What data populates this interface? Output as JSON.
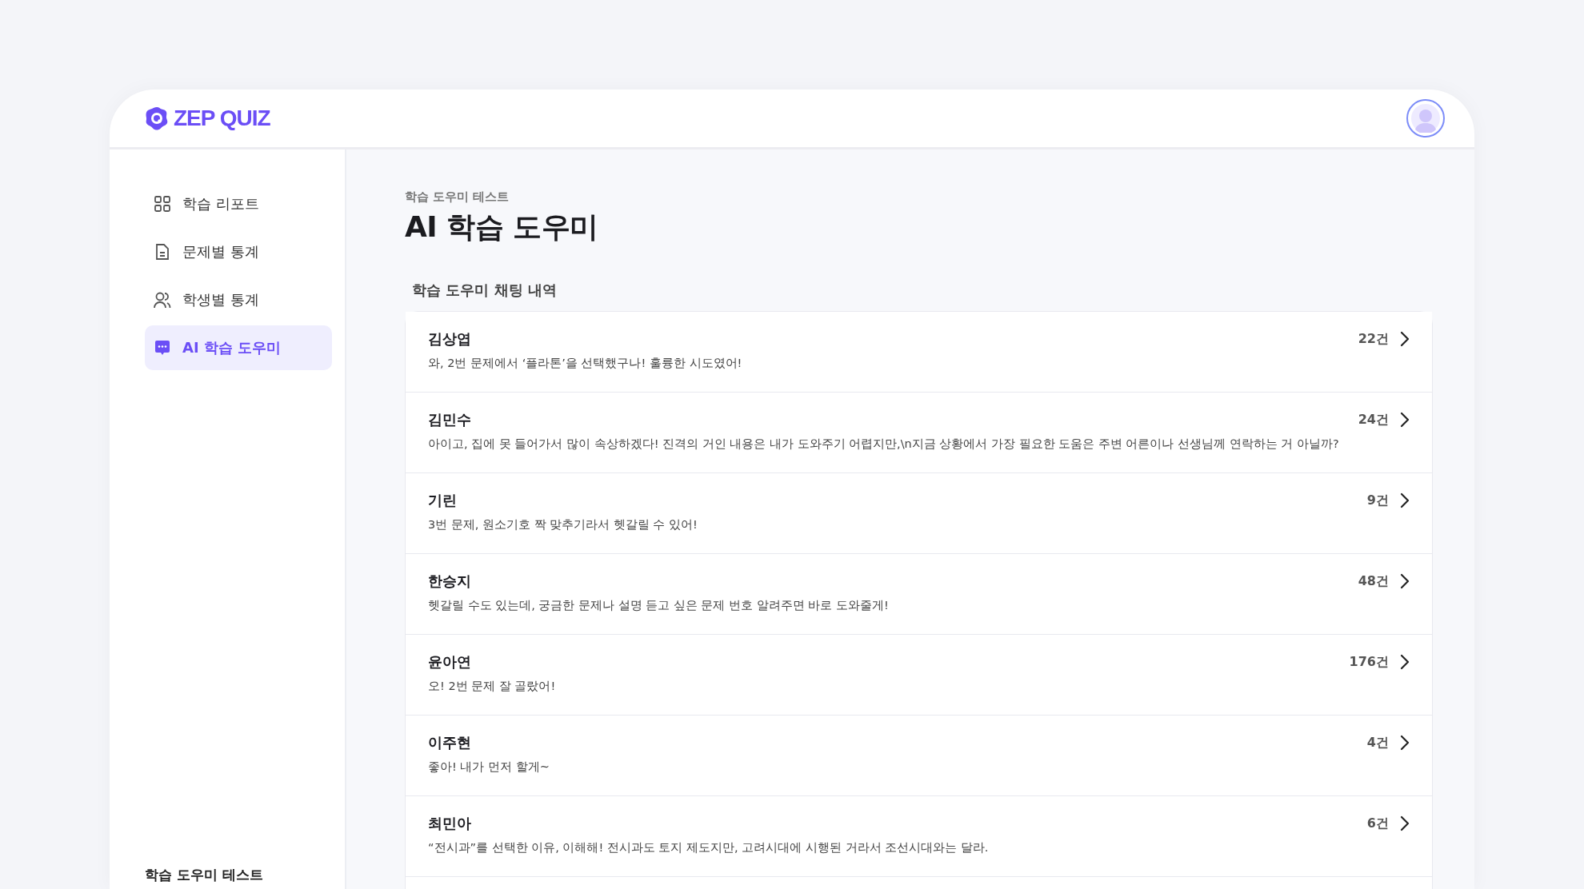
{
  "header": {
    "logo": "ZEP QUIZ"
  },
  "sidebar": {
    "items": [
      {
        "label": "학습 리포트",
        "kind": "grid",
        "selected": false
      },
      {
        "label": "문제별 통계",
        "kind": "document",
        "selected": false
      },
      {
        "label": "학생별 통계",
        "kind": "users",
        "selected": false
      },
      {
        "label": "AI 학습 도우미",
        "kind": "chat",
        "selected": true
      }
    ],
    "footer": "학습 도우미 테스트"
  },
  "main": {
    "breadcrumb": "학습 도우미 테스트",
    "title": "AI 학습 도우미",
    "section_title": "학습 도우미 채팅 내역",
    "chats": [
      {
        "name": "김상엽",
        "message": "와, 2번 문제에서 ‘플라톤’을 선택했구나! 훌륭한 시도였어!",
        "count": "22건"
      },
      {
        "name": "김민수",
        "message": "아이고, 집에 못 들어가서 많이 속상하겠다! 진격의 거인 내용은 내가 도와주기 어렵지만,\\n지금 상황에서 가장 필요한 도움은 주변 어른이나 선생님께 연락하는 거 아닐까?",
        "count": "24건"
      },
      {
        "name": "기린",
        "message": "3번 문제, 원소기호 짝 맞추기라서 헷갈릴 수 있어!",
        "count": "9건"
      },
      {
        "name": "한승지",
        "message": "헷갈릴 수도 있는데, 궁금한 문제나 설명 듣고 싶은 문제 번호 알려주면 바로 도와줄게!",
        "count": "48건"
      },
      {
        "name": "윤아연",
        "message": "오! 2번 문제 잘 골랐어!",
        "count": "176건"
      },
      {
        "name": "이주현",
        "message": "좋아! 내가 먼저 할게~",
        "count": "4건"
      },
      {
        "name": "최민아",
        "message": "“전시과”를 선택한 이유, 이해해! 전시과도 토지 제도지만, 고려시대에 시행된 거라서 조선시대와는 달라.",
        "count": "6건"
      }
    ]
  }
}
